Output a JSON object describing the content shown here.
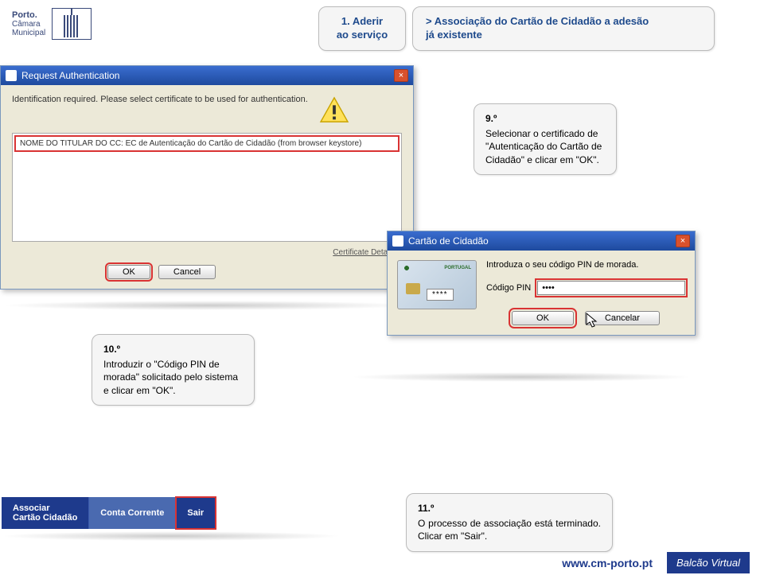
{
  "logo": {
    "line1": "Porto.",
    "line2": "Câmara",
    "line3": "Municipal"
  },
  "header": {
    "box1_line1": "1. Aderir",
    "box1_line2": "ao serviço",
    "box2_line1": "> Associação do Cartão de Cidadão a adesão",
    "box2_line2": "já existente"
  },
  "auth_dialog": {
    "title": "Request Authentication",
    "prompt": "Identification required. Please select certificate to be used for authentication.",
    "cert_row": "NOME DO TITULAR DO CC: EC de Autenticação do Cartão de Cidadão (from browser keystore)",
    "details": "Certificate Details...",
    "ok": "OK",
    "cancel": "Cancel"
  },
  "step9": {
    "num": "9.º",
    "text": "Selecionar o certificado de \"Autenticação do Cartão de Cidadão\" e clicar em \"OK\"."
  },
  "cc_dialog": {
    "title": "Cartão de Cidadão",
    "card_pt": "PORTUGAL",
    "card_dots": "****",
    "prompt": "Introduza o seu código PIN de morada.",
    "pin_label": "Código PIN",
    "pin_value": "••••",
    "ok": "OK",
    "cancel": "Cancelar"
  },
  "step10": {
    "num": "10.º",
    "text": "Introduzir o \"Código PIN de morada\" solicitado pelo sistema e clicar em \"OK\"."
  },
  "nav": {
    "assoc1": "Associar",
    "assoc2": "Cartão Cidadão",
    "conta": "Conta Corrente",
    "sair": "Sair"
  },
  "step11": {
    "num": "11.º",
    "text": "O processo de associação está terminado. Clicar em \"Sair\"."
  },
  "footer": {
    "url": "www.cm-porto.pt",
    "balcao": "Balcão Virtual"
  }
}
